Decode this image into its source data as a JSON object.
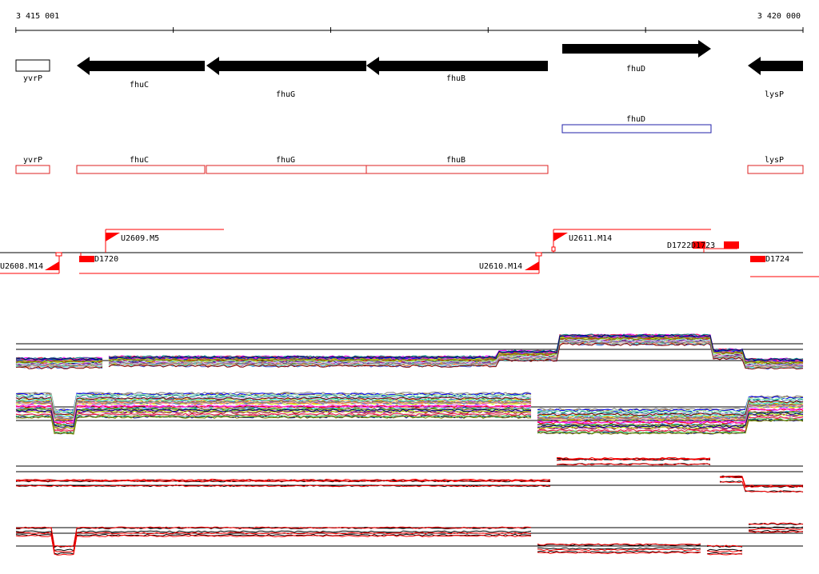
{
  "ruler": {
    "start_label": "3 415 001",
    "end_label": "3 420 000",
    "start": 3415001,
    "end": 3420000
  },
  "colors": {
    "gene_arrow": "#000000",
    "annotation_box": "#dd2222",
    "fhud_box": "#2222aa",
    "probe": "#ff0000",
    "grid": "#000000"
  },
  "genes": [
    {
      "name": "yvrP",
      "start": 3415001,
      "end": 3415214,
      "strand": "+",
      "outline": true
    },
    {
      "name": "fhuC",
      "start": 3415387,
      "end": 3416182,
      "strand": "-"
    },
    {
      "name": "fhuG",
      "start": 3416197,
      "end": 3417213,
      "strand": "-"
    },
    {
      "name": "fhuB",
      "start": 3417213,
      "end": 3418354,
      "strand": "-"
    },
    {
      "name": "fhuD",
      "start": 3418437,
      "end": 3419378,
      "strand": "+"
    },
    {
      "name": "lysP",
      "start": 3419695,
      "end": 3420000,
      "strand": "-"
    }
  ],
  "annotation_fhud": {
    "name": "fhuD",
    "start": 3418437,
    "end": 3419378
  },
  "annotations": [
    {
      "name": "yvrP",
      "start": 3415001,
      "end": 3415214
    },
    {
      "name": "fhuC",
      "start": 3415387,
      "end": 3416182
    },
    {
      "name": "fhuG",
      "start": 3416197,
      "end": 3417213
    },
    {
      "name": "fhuB",
      "start": 3417213,
      "end": 3418354
    }
  ],
  "annotations_right": [
    {
      "name": "lysP",
      "start": 3419695,
      "end": 3420000
    }
  ],
  "features": {
    "top": [
      {
        "name": "U2609.M5",
        "start": 3415565,
        "end": 3416310
      },
      {
        "name": "U2611.M14",
        "start": 3418380,
        "end": 3419378
      },
      {
        "name": "D1722",
        "start": 3419075,
        "end": 3419300
      },
      {
        "name": "D1723",
        "start": 3419230,
        "end": 3419520
      }
    ],
    "bottom": [
      {
        "name": "U2608.M14",
        "start": 3414650,
        "end": 3415275
      },
      {
        "name": "D1720",
        "start": 3415410,
        "end": 3415510
      },
      {
        "name": "U2610.M14",
        "start": 3415410,
        "end": 3418325
      },
      {
        "name": "D1724",
        "start": 3419700,
        "end": 3420000
      }
    ]
  }
}
